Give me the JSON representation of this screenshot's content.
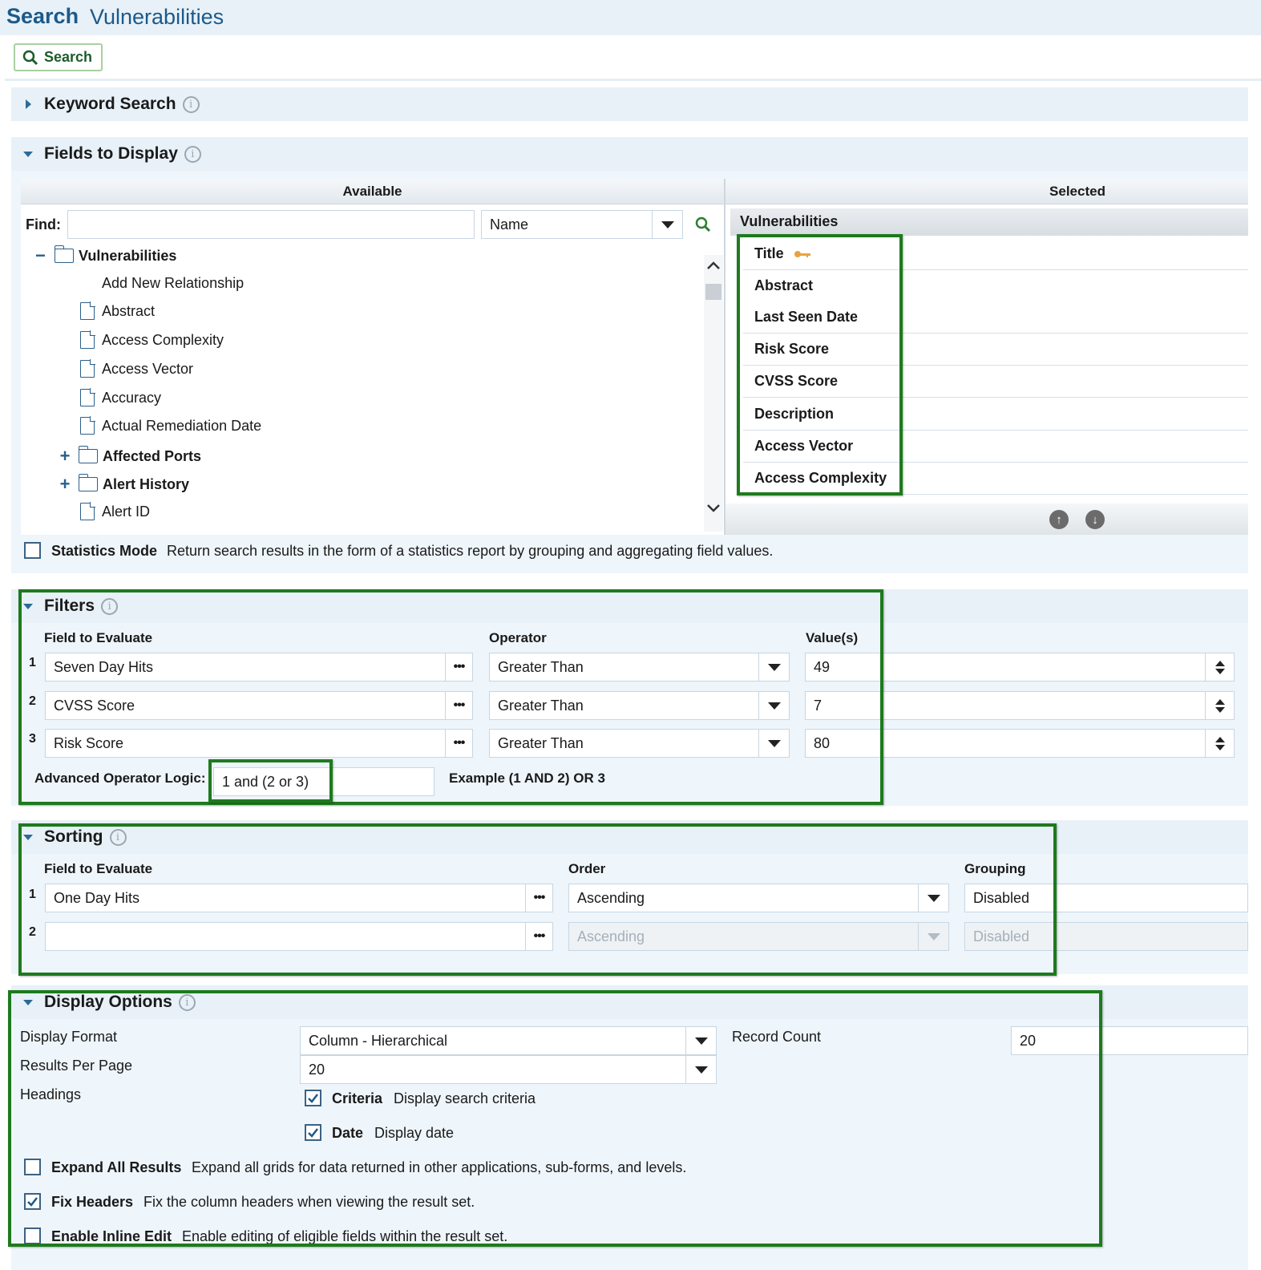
{
  "header": {
    "title": "Search",
    "subtitle": "Vulnerabilities"
  },
  "toolbar": {
    "search_label": "Search"
  },
  "keyword_search": {
    "title": "Keyword Search",
    "info": "i"
  },
  "fields_to_display": {
    "title": "Fields to Display",
    "info": "i",
    "available_header": "Available",
    "selected_header": "Selected",
    "find_label": "Find:",
    "find_value": "",
    "find_by": "Name",
    "tree": {
      "root": "Vulnerabilities",
      "collapse_symbol": "−",
      "expand_symbol": "+",
      "add_relationship": "Add New Relationship",
      "items": [
        "Abstract",
        "Access Complexity",
        "Access Vector",
        "Accuracy",
        "Actual Remediation Date",
        "Affected Ports",
        "Alert History",
        "Alert ID"
      ]
    },
    "selected_group": "Vulnerabilities",
    "selected_items": [
      "Title",
      "Abstract",
      "Last Seen Date",
      "Risk Score",
      "CVSS Score",
      "Description",
      "Access Vector",
      "Access Complexity"
    ],
    "move_up": "↑",
    "move_down": "↓"
  },
  "statistics_mode": {
    "label": "Statistics Mode",
    "description": "Return search results in the form of a statistics report by grouping and aggregating field values."
  },
  "filters": {
    "title": "Filters",
    "info": "i",
    "col_field": "Field to Evaluate",
    "col_operator": "Operator",
    "col_values": "Value(s)",
    "rows": [
      {
        "n": "1",
        "field": "Seven Day Hits",
        "operator": "Greater Than",
        "value": "49"
      },
      {
        "n": "2",
        "field": "CVSS Score",
        "operator": "Greater Than",
        "value": "7"
      },
      {
        "n": "3",
        "field": "Risk Score",
        "operator": "Greater Than",
        "value": "80"
      }
    ],
    "dots": "•••",
    "advanced_label": "Advanced Operator Logic:",
    "advanced_value": "1 and (2 or 3)",
    "example": "Example (1 AND 2) OR 3"
  },
  "sorting": {
    "title": "Sorting",
    "info": "i",
    "col_field": "Field to Evaluate",
    "col_order": "Order",
    "col_grouping": "Grouping",
    "rows": [
      {
        "n": "1",
        "field": "One Day Hits",
        "order": "Ascending",
        "grouping": "Disabled"
      },
      {
        "n": "2",
        "field": "",
        "order": "Ascending",
        "grouping": "Disabled"
      }
    ]
  },
  "display_options": {
    "title": "Display Options",
    "info": "i",
    "display_format_label": "Display Format",
    "display_format_value": "Column - Hierarchical",
    "record_count_label": "Record Count",
    "record_count_value": "20",
    "results_per_page_label": "Results Per Page",
    "results_per_page_value": "20",
    "headings_label": "Headings",
    "criteria_label": "Criteria",
    "criteria_desc": "Display search criteria",
    "date_label": "Date",
    "date_desc": "Display date",
    "expand_label": "Expand All Results",
    "expand_desc": "Expand all grids for data returned in other applications, sub-forms, and levels.",
    "fix_headers_label": "Fix Headers",
    "fix_headers_desc": "Fix the column headers when viewing the result set.",
    "inline_edit_label": "Enable Inline Edit",
    "inline_edit_desc": "Enable editing of eligible fields within the result set."
  },
  "colors": {
    "accent": "#1b5a8a",
    "highlight_box": "#1e7a1e",
    "section_bg": "#e8f1f8"
  }
}
